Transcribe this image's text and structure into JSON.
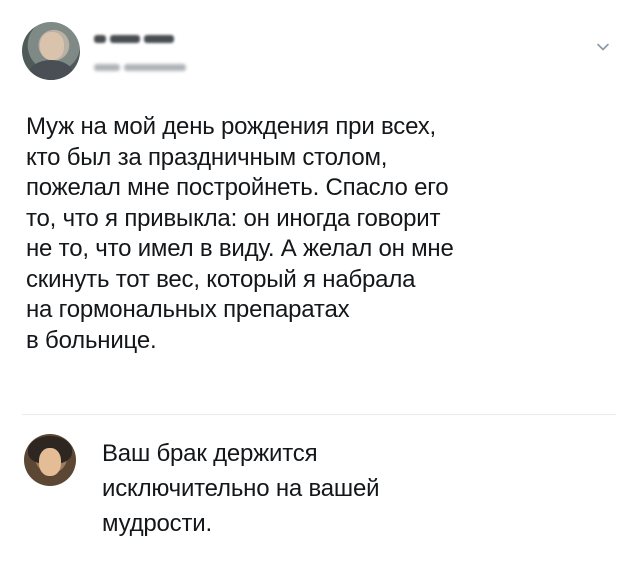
{
  "tweet": {
    "text": "Муж на мой день рождения при всех,\nкто был за праздничным столом,\nпожелал мне постройнеть. Спасло его\nто, что я привыкла: он иногда говорит\nне то, что имел в виду. А желал он мне\nскинуть тот вес, который я набрала\nна гормональных препаратах\nв больнице.",
    "menu_icon": "chevron-down-icon"
  },
  "reply": {
    "text": "Ваш брак держится\nисключительно на вашей\nмудрости."
  },
  "colors": {
    "text": "#14171a",
    "divider": "#e6ecf0",
    "icon": "#8899a6"
  }
}
